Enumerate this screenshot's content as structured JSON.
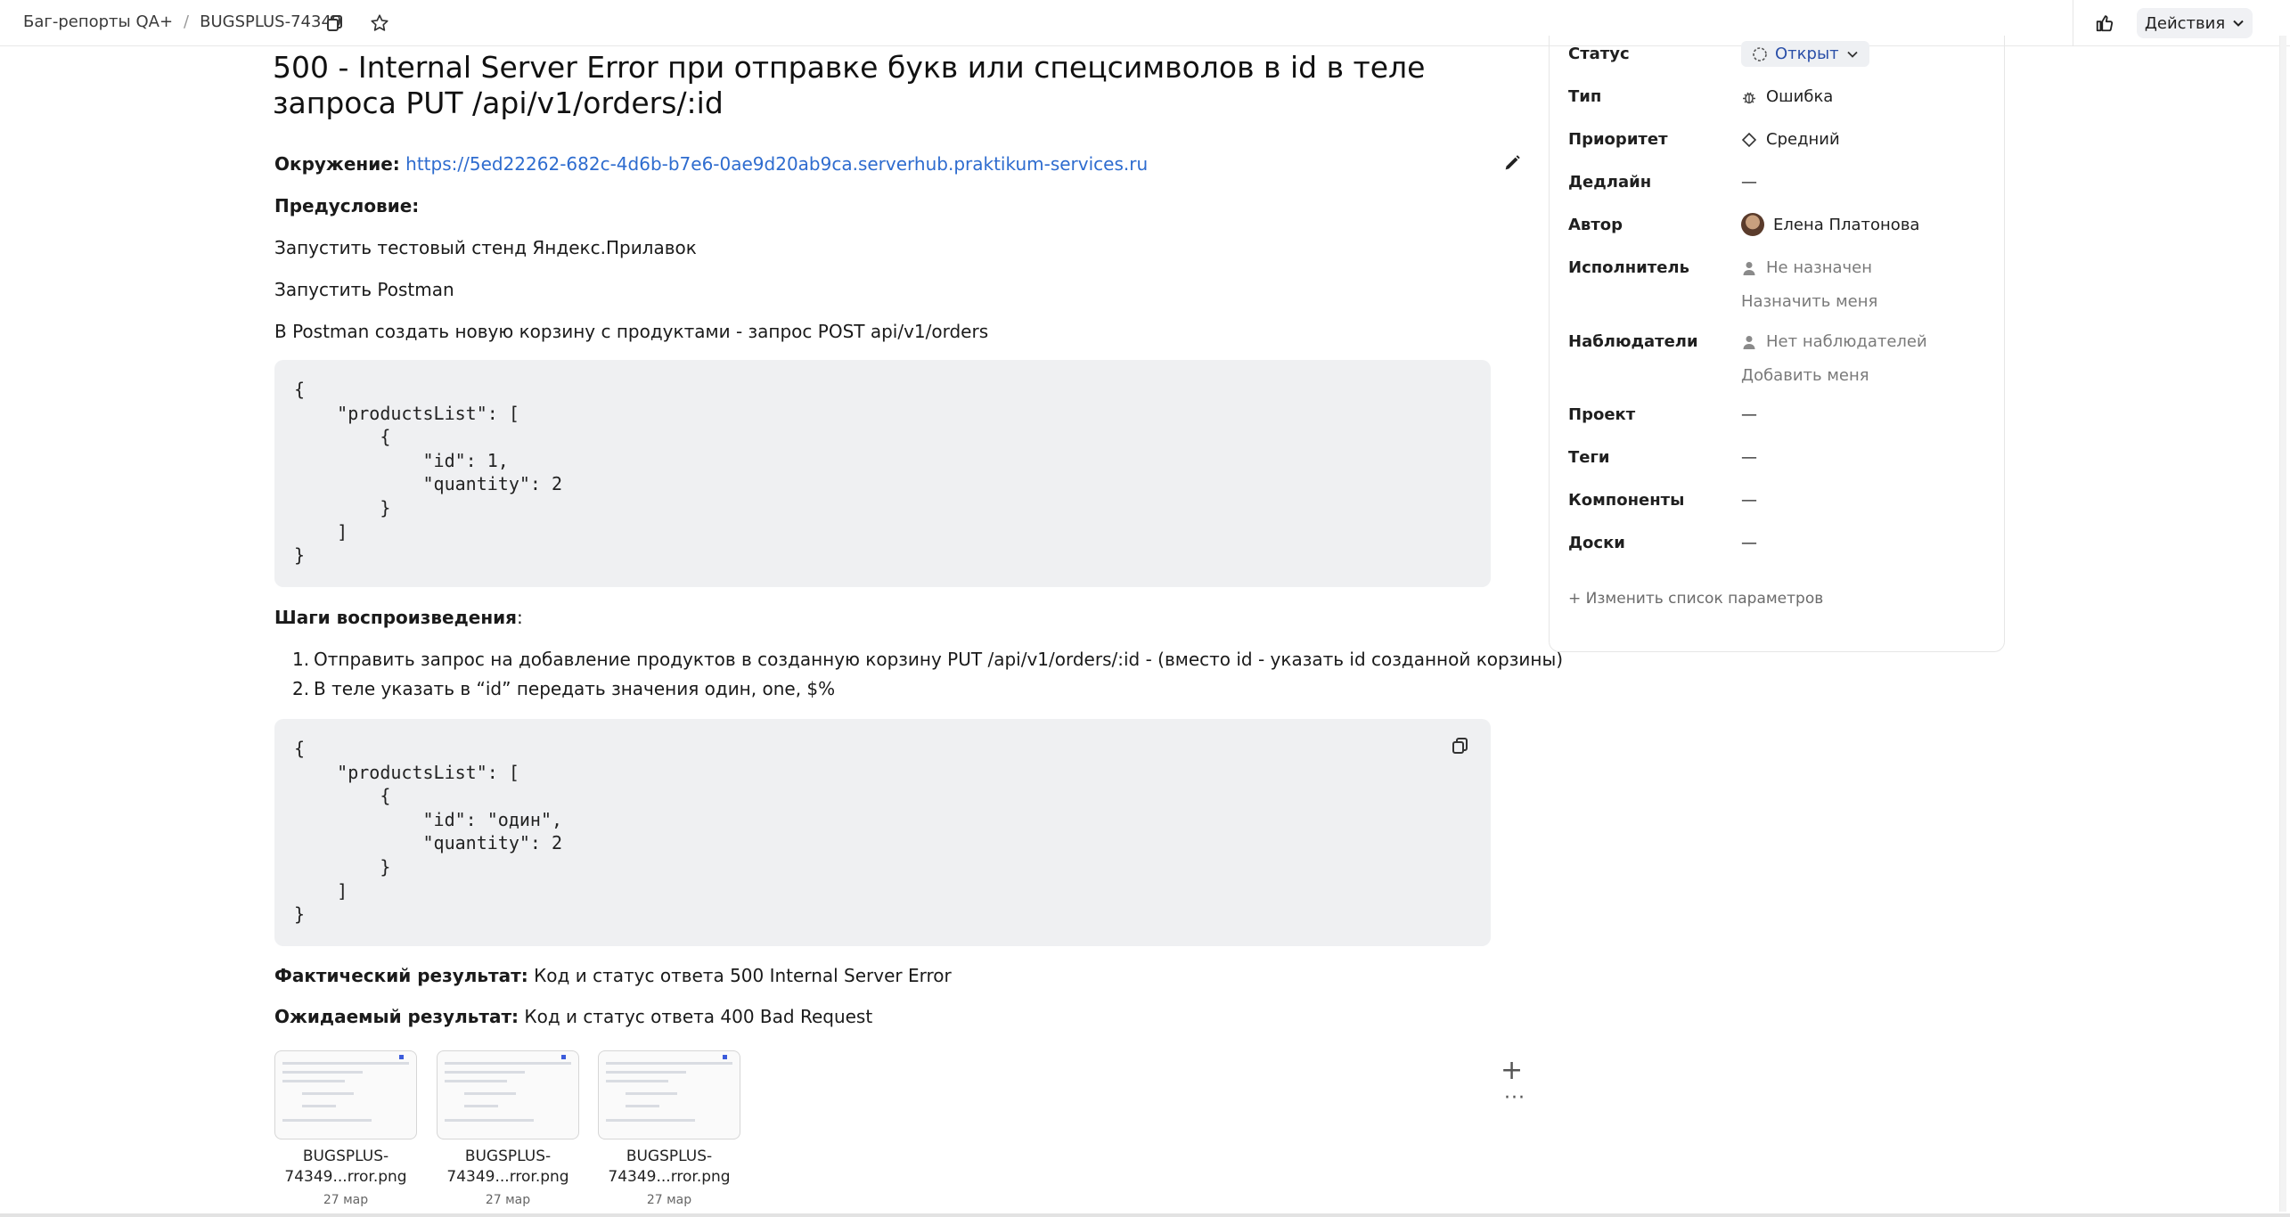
{
  "breadcrumb": {
    "queue": "Баг-репорты QA+",
    "separator": "/",
    "key": "BUGSPLUS-74349"
  },
  "header": {
    "actions_label": "Действия"
  },
  "issue": {
    "title": "500 - Internal Server Error при отправке букв или спецсимволов в id в теле запроса PUT /api/v1/orders/:id",
    "env_label": "Окружение:",
    "env_url": "https://5ed22262-682c-4d6b-b7e6-0ae9d20ab9ca.serverhub.praktikum-services.ru",
    "precondition_label": "Предусловие:",
    "pre_lines": [
      "Запустить тестовый стенд Яндекс.Прилавок",
      "Запустить Postman",
      "В Postman создать новую корзину с продуктами - запрос POST api/v1/orders"
    ],
    "code1": "{\n    \"productsList\": [\n        {\n            \"id\": 1,\n            \"quantity\": 2\n        }\n    ]\n}",
    "steps_label": "Шаги воспроизведения",
    "steps_colon": ":",
    "steps": [
      {
        "num": "1.",
        "text": "Отправить запрос на добавление продуктов в созданную корзину PUT /api/v1/orders/:id - (вместо id - указать id созданной корзины)"
      },
      {
        "num": "2.",
        "text": "В теле указать в “id” передать значения один, one, $%"
      }
    ],
    "code2": "{\n    \"productsList\": [\n        {\n            \"id\": \"один\",\n            \"quantity\": 2\n        }\n    ]\n}",
    "actual_label": "Фактический результат:",
    "actual_text": " Код и статус ответа 500 Internal Server Error",
    "expected_label": "Ожидаемый результат:",
    "expected_text": " Код и статус ответа 400 Bad Request"
  },
  "attachments": [
    {
      "name_line1": "BUGSPLUS-",
      "name_line2": "74349...rror.png",
      "date": "27 мар"
    },
    {
      "name_line1": "BUGSPLUS-",
      "name_line2": "74349...rror.png",
      "date": "27 мар"
    },
    {
      "name_line1": "BUGSPLUS-",
      "name_line2": "74349...rror.png",
      "date": "27 мар"
    }
  ],
  "side_controls": {
    "add": "+",
    "more": "···"
  },
  "properties": {
    "status": {
      "label": "Статус",
      "value": "Открыт"
    },
    "type": {
      "label": "Тип",
      "value": "Ошибка"
    },
    "priority": {
      "label": "Приоритет",
      "value": "Средний"
    },
    "deadline": {
      "label": "Дедлайн",
      "value": "—"
    },
    "author": {
      "label": "Автор",
      "value": "Елена Платонова"
    },
    "assignee": {
      "label": "Исполнитель",
      "value": "Не назначен",
      "action": "Назначить меня"
    },
    "followers": {
      "label": "Наблюдатели",
      "value": "Нет наблюдателей",
      "action": "Добавить меня"
    },
    "project": {
      "label": "Проект",
      "value": "—"
    },
    "tags": {
      "label": "Теги",
      "value": "—"
    },
    "components": {
      "label": "Компоненты",
      "value": "—"
    },
    "boards": {
      "label": "Доски",
      "value": "—"
    },
    "edit_params": "Изменить список параметров"
  }
}
